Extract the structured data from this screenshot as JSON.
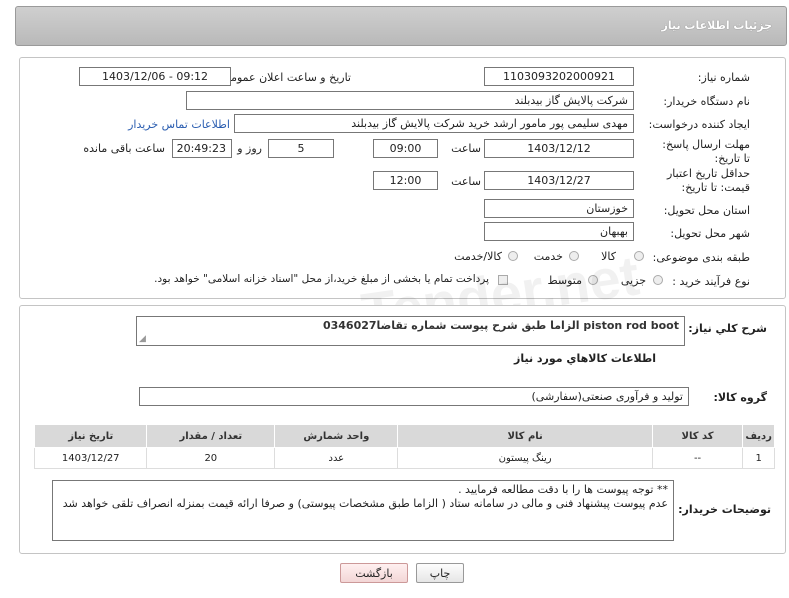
{
  "header": {
    "title": "جزئیات اطلاعات نیاز"
  },
  "fields": {
    "need_number_label": "شماره نیاز:",
    "need_number": "1103093202000921",
    "announce_label": "تاریخ و ساعت اعلان عمومی:",
    "announce_value": "1403/12/06 - 09:12",
    "buyer_label": "نام دستگاه خریدار:",
    "buyer_value": "شرکت پالایش گاز بیدبلند",
    "creator_label": "ایجاد کننده درخواست:",
    "creator_value": "مهدی سلیمی پور مامور ارشد خرید شرکت پالایش گاز بیدبلند",
    "contact_link": "اطلاعات تماس خریدار",
    "deadline_label": "مهلت ارسال پاسخ: تا تاریخ:",
    "deadline_date": "1403/12/12",
    "time_label": "ساعت",
    "deadline_time": "09:00",
    "days_value": "5",
    "days_label": "روز و",
    "remaining_time": "20:49:23",
    "remaining_label": "ساعت باقی مانده",
    "validity_label": "حداقل تاریخ اعتبار قیمت: تا تاریخ:",
    "validity_date": "1403/12/27",
    "validity_time_label": "ساعت",
    "validity_time": "12:00",
    "province_label": "استان محل تحویل:",
    "province_value": "خوزستان",
    "city_label": "شهر محل تحویل:",
    "city_value": "بهبهان",
    "category_label": "طبقه بندی موضوعی:",
    "category_options": [
      "کالا",
      "خدمت",
      "کالا/خدمت"
    ],
    "process_label": "نوع فرآیند خرید :",
    "process_options": [
      "جزیی",
      "متوسط"
    ],
    "payment_note": "پرداخت تمام یا بخشی از مبلغ خرید،از محل \"اسناد خزانه اسلامی\" خواهد بود."
  },
  "description": {
    "label": "شرح کلي نياز:",
    "value": "piston rod boot الزاما طبق شرح پیوست شماره تقاضا0346027"
  },
  "goods": {
    "section_title": "اطلاعات کالاهاي مورد نياز",
    "group_label": "گروه کالا:",
    "group_value": "تولید و فرآوری صنعتی(سفارشی)",
    "columns": [
      "ردیف",
      "کد کالا",
      "نام کالا",
      "واحد شمارش",
      "تعداد / مقدار",
      "تاریخ نیاز"
    ],
    "rows": [
      [
        "1",
        "--",
        "رینگ پیستون",
        "عدد",
        "20",
        "1403/12/27"
      ]
    ]
  },
  "notes": {
    "label": "توضیحات خریدار:",
    "line1": "** توجه پیوست ها  را با دقت مطالعه فرمایید .",
    "line2": "عدم پیوست پیشنهاد فنی و مالی در سامانه ستاد ( الزاما طبق مشخصات پیوستی)  و صرفا ارائه قیمت بمنزله انصراف تلقی خواهد شد"
  },
  "buttons": {
    "print": "چاپ",
    "back": "بازگشت"
  },
  "watermark": "ParsTender.net",
  "colors": {
    "link": "#2a5db0",
    "header": "#c4c4c4"
  }
}
